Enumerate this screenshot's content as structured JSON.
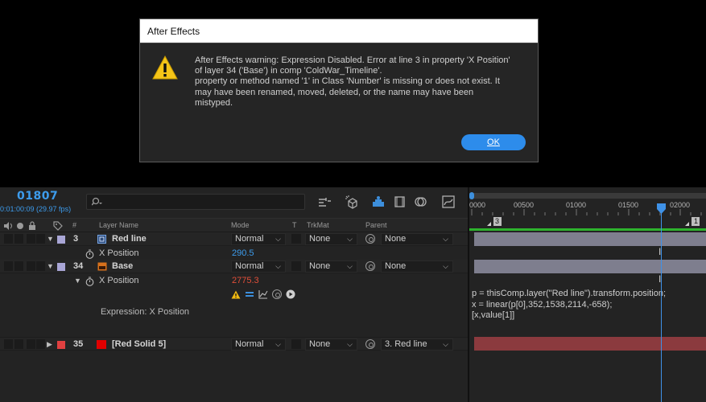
{
  "dialog": {
    "title": "After Effects",
    "icon": "warning-icon",
    "message_lines": [
      "After Effects warning: Expression Disabled. Error at line 3 in property 'X Position'",
      "of layer 34 ('Base') in comp 'ColdWar_Timeline'.",
      "property or method named '1' in Class 'Number' is missing or does not exist. It",
      "may have been renamed, moved, deleted, or the name may have been",
      "mistyped."
    ],
    "ok_label": "OK"
  },
  "timeline": {
    "timecode": "01807",
    "timecode_sub": "0:01:00:09 (29.97 fps)",
    "search_placeholder": "",
    "columns": {
      "hash": "#",
      "layer_name": "Layer Name",
      "mode": "Mode",
      "t": "T",
      "trkmat": "TrkMat",
      "parent": "Parent"
    },
    "layers": [
      {
        "number": "3",
        "name": "Red line",
        "label_color": "#a9a6d6",
        "icon": "precomp-icon",
        "mode": "Normal",
        "trkmat": "None",
        "parent": "None",
        "property_name": "X Position",
        "property_value": "290.5",
        "property_value_color": "#3d9ced"
      },
      {
        "number": "34",
        "name": "Base",
        "label_color": "#a9a6d6",
        "icon": "illustrator-file-icon",
        "mode": "Normal",
        "trkmat": "None",
        "parent": "None",
        "property_name": "X Position",
        "property_value": "2775.3",
        "property_value_color": "#e04e39",
        "expression_label": "Expression: X Position"
      },
      {
        "number": "35",
        "name": "[Red Solid 5]",
        "label_color": "#e04040",
        "icon": "solid-icon",
        "mode": "Normal",
        "trkmat": "None",
        "parent": "3. Red line"
      }
    ],
    "ruler_ticks": [
      "0000",
      "00500",
      "01000",
      "01500",
      "02000"
    ],
    "layer_markers": [
      "3",
      "1"
    ],
    "expression_code": [
      "p = thisComp.layer(\"Red line\").transform.position;",
      "x = linear(p[0],352,1538,2114,-658);",
      "[x,value[1]]"
    ],
    "colors": {
      "accent": "#3d9ced",
      "bar_gray": "#7e7e8e",
      "bar_red": "#8b3a3e",
      "ok_button": "#2d8ceb"
    }
  }
}
